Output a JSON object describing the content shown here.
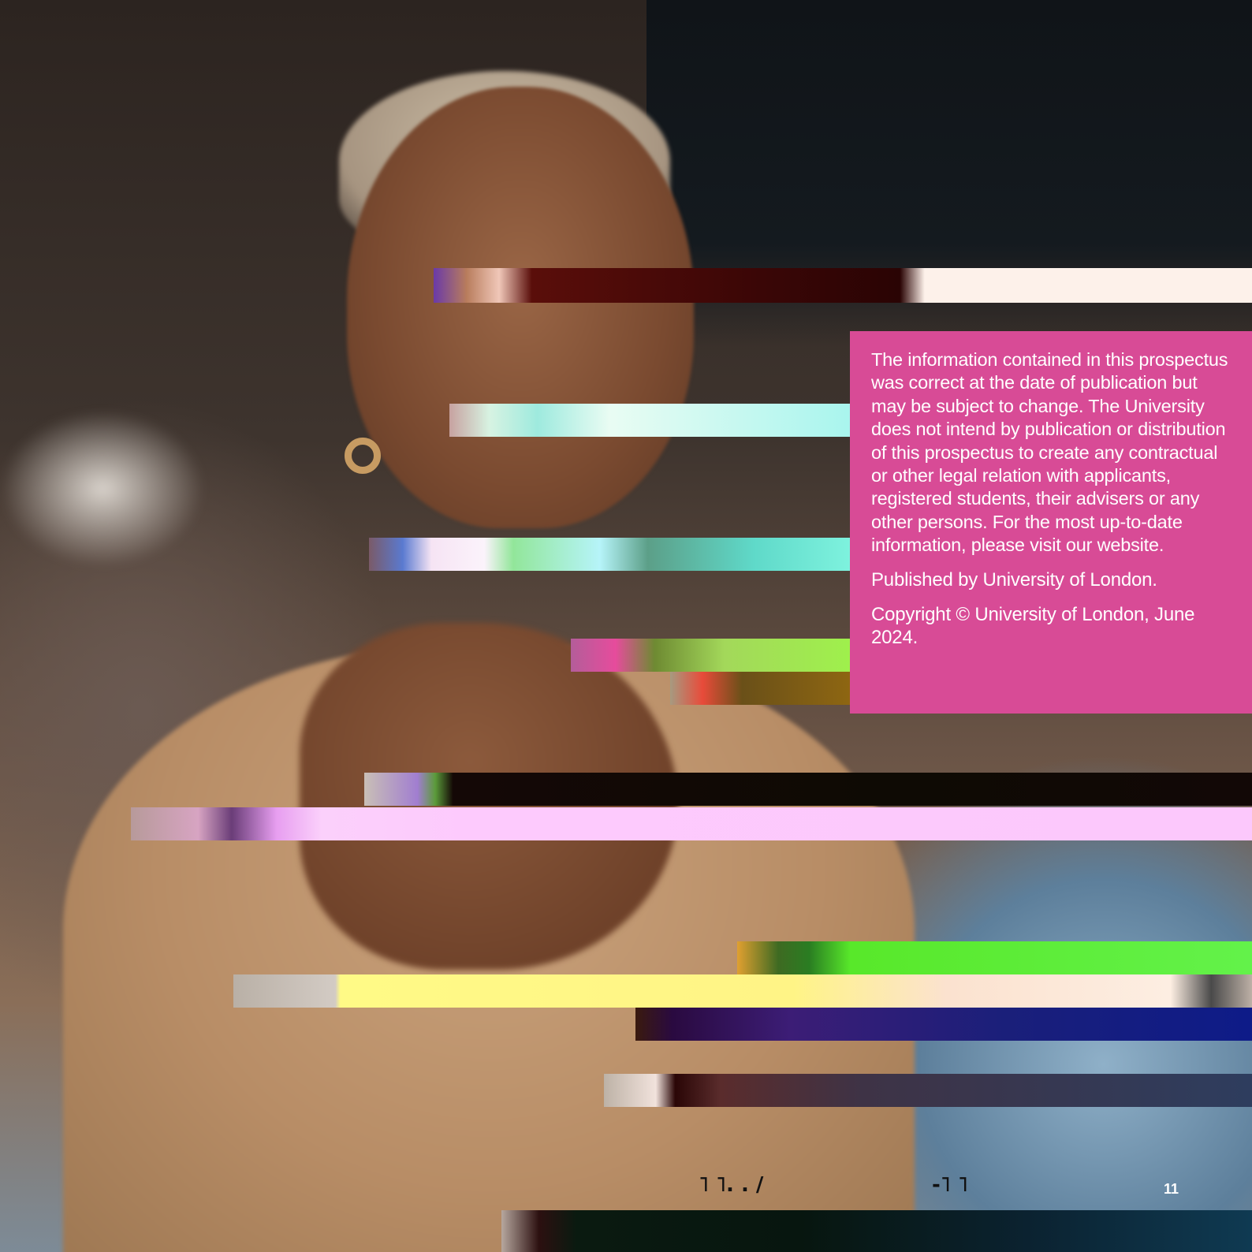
{
  "disclaimer": {
    "body": "The information contained in this prospectus was correct at the date of publication but may be subject to change. The University does not intend by publication or distribution of this prospectus to create any contractual or other legal relation with applicants, registered students, their advisers or any other persons. For the most up-to-date information, please visit our website.",
    "publisher": "Published by University of London.",
    "copyright": "Copyright © University of London, June 2024."
  },
  "footer": {
    "page_number": "11",
    "garbled_left": "˥ ˥. . /",
    "garbled_right": "-˥ ˥"
  },
  "colors": {
    "panel": "#d84b96",
    "panel_text": "#ffffff"
  }
}
